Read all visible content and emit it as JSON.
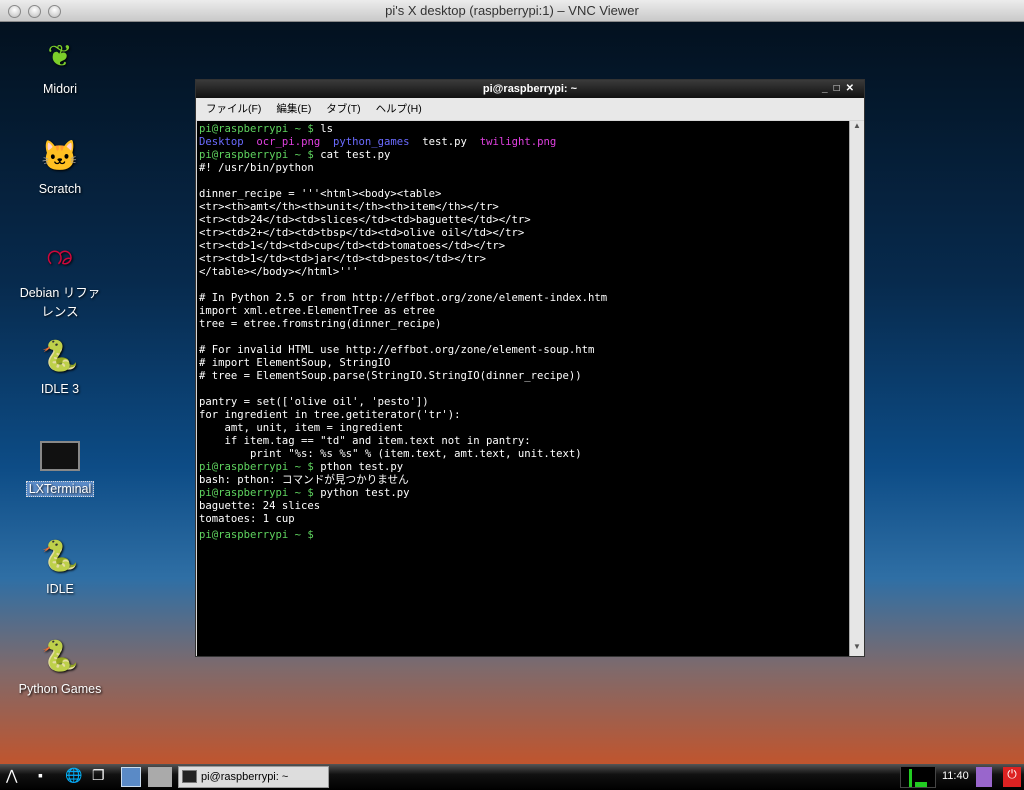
{
  "window_title": "pi's X desktop (raspberrypi:1) – VNC Viewer",
  "desktop_icons": [
    {
      "label": "Midori",
      "icon": "midori-icon"
    },
    {
      "label": "Scratch",
      "icon": "scratch-icon"
    },
    {
      "label": "Debian リファレンス",
      "icon": "debian-icon"
    },
    {
      "label": "IDLE 3",
      "icon": "python-icon"
    },
    {
      "label": "LXTerminal",
      "icon": "terminal-icon"
    },
    {
      "label": "IDLE",
      "icon": "python-icon"
    },
    {
      "label": "Python Games",
      "icon": "python-icon"
    }
  ],
  "terminal": {
    "title": "pi@raspberrypi: ~",
    "menu": [
      "ファイル(F)",
      "編集(E)",
      "タブ(T)",
      "ヘルプ(H)"
    ],
    "lines": [
      [
        {
          "t": "pi@raspberrypi ~ $ ",
          "c": "#5fd35f"
        },
        {
          "t": "ls",
          "c": "#fff"
        }
      ],
      [
        {
          "t": "Desktop",
          "c": "#6b6bff"
        },
        {
          "t": "  ",
          "c": "#fff"
        },
        {
          "t": "ocr_pi.png",
          "c": "#e040e0"
        },
        {
          "t": "  ",
          "c": "#fff"
        },
        {
          "t": "python_games",
          "c": "#6b6bff"
        },
        {
          "t": "  test.py  ",
          "c": "#fff"
        },
        {
          "t": "twilight.png",
          "c": "#e040e0"
        }
      ],
      [
        {
          "t": "pi@raspberrypi ~ $ ",
          "c": "#5fd35f"
        },
        {
          "t": "cat test.py",
          "c": "#fff"
        }
      ],
      [
        {
          "t": "#! /usr/bin/python",
          "c": "#fff"
        }
      ],
      [
        {
          "t": "",
          "c": "#fff"
        }
      ],
      [
        {
          "t": "dinner_recipe = '''<html><body><table>",
          "c": "#fff"
        }
      ],
      [
        {
          "t": "<tr><th>amt</th><th>unit</th><th>item</th></tr>",
          "c": "#fff"
        }
      ],
      [
        {
          "t": "<tr><td>24</td><td>slices</td><td>baguette</td></tr>",
          "c": "#fff"
        }
      ],
      [
        {
          "t": "<tr><td>2+</td><td>tbsp</td><td>olive oil</td></tr>",
          "c": "#fff"
        }
      ],
      [
        {
          "t": "<tr><td>1</td><td>cup</td><td>tomatoes</td></tr>",
          "c": "#fff"
        }
      ],
      [
        {
          "t": "<tr><td>1</td><td>jar</td><td>pesto</td></tr>",
          "c": "#fff"
        }
      ],
      [
        {
          "t": "</table></body></html>'''",
          "c": "#fff"
        }
      ],
      [
        {
          "t": "",
          "c": "#fff"
        }
      ],
      [
        {
          "t": "# In Python 2.5 or from http://effbot.org/zone/element-index.htm",
          "c": "#fff"
        }
      ],
      [
        {
          "t": "import xml.etree.ElementTree as etree",
          "c": "#fff"
        }
      ],
      [
        {
          "t": "tree = etree.fromstring(dinner_recipe)",
          "c": "#fff"
        }
      ],
      [
        {
          "t": "",
          "c": "#fff"
        }
      ],
      [
        {
          "t": "# For invalid HTML use http://effbot.org/zone/element-soup.htm",
          "c": "#fff"
        }
      ],
      [
        {
          "t": "# import ElementSoup, StringIO",
          "c": "#fff"
        }
      ],
      [
        {
          "t": "# tree = ElementSoup.parse(StringIO.StringIO(dinner_recipe))",
          "c": "#fff"
        }
      ],
      [
        {
          "t": "",
          "c": "#fff"
        }
      ],
      [
        {
          "t": "pantry = set(['olive oil', 'pesto'])",
          "c": "#fff"
        }
      ],
      [
        {
          "t": "for ingredient in tree.getiterator('tr'):",
          "c": "#fff"
        }
      ],
      [
        {
          "t": "    amt, unit, item = ingredient",
          "c": "#fff"
        }
      ],
      [
        {
          "t": "    if item.tag == \"td\" and item.text not in pantry:",
          "c": "#fff"
        }
      ],
      [
        {
          "t": "        print \"%s: %s %s\" % (item.text, amt.text, unit.text)",
          "c": "#fff"
        }
      ],
      [
        {
          "t": "pi@raspberrypi ~ $ ",
          "c": "#5fd35f"
        },
        {
          "t": "pthon test.py",
          "c": "#fff"
        }
      ],
      [
        {
          "t": "bash: pthon: コマンドが見つかりません",
          "c": "#fff"
        }
      ],
      [
        {
          "t": "pi@raspberrypi ~ $ ",
          "c": "#5fd35f"
        },
        {
          "t": "python test.py",
          "c": "#fff"
        }
      ],
      [
        {
          "t": "baguette: 24 slices",
          "c": "#fff"
        }
      ],
      [
        {
          "t": "tomatoes: 1 cup",
          "c": "#fff"
        }
      ],
      [
        {
          "t": "pi@raspberrypi ~ $ ",
          "c": "#5fd35f"
        }
      ]
    ]
  },
  "taskbar": {
    "task_label": "pi@raspberrypi: ~",
    "clock": "11:40"
  }
}
